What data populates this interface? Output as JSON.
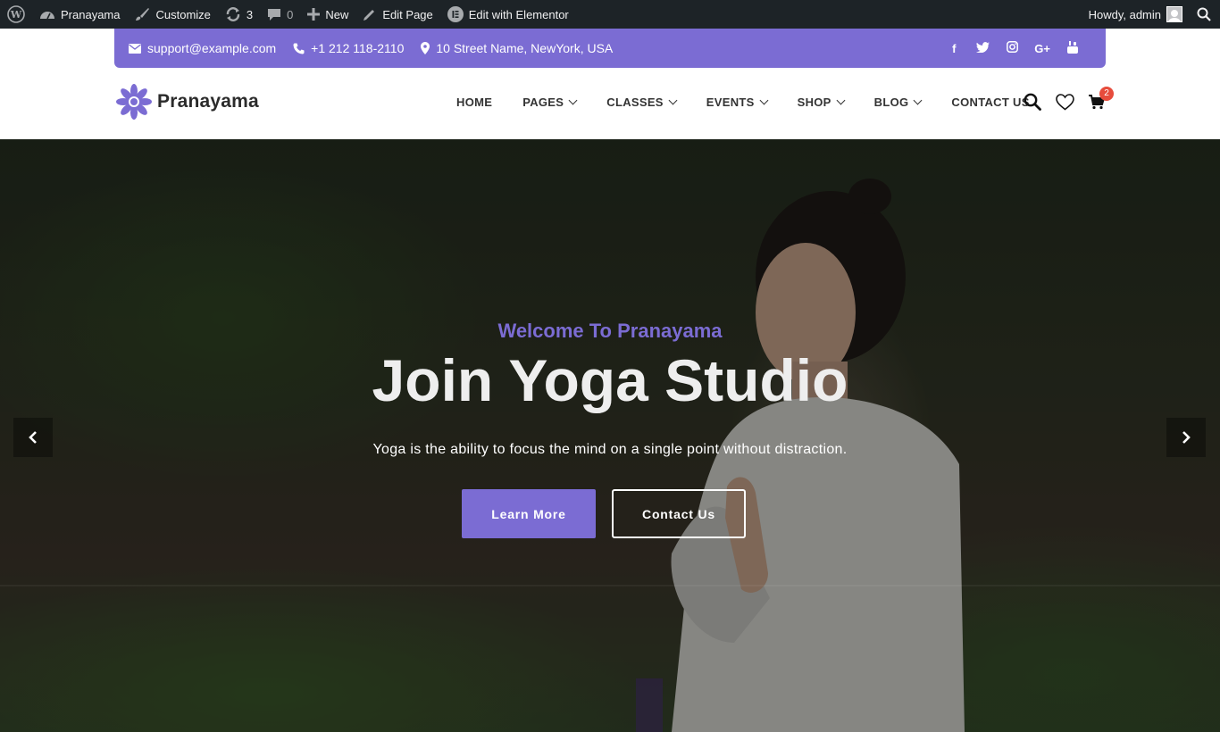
{
  "admin_bar": {
    "site_name": "Pranayama",
    "customize": "Customize",
    "updates_count": "3",
    "comments_count": "0",
    "new": "New",
    "edit_page": "Edit Page",
    "edit_elementor": "Edit with Elementor",
    "howdy": "Howdy, admin",
    "icons": [
      "wordpress-logo-icon",
      "dashboard-icon",
      "brush-icon",
      "refresh-icon",
      "comment-icon",
      "plus-icon",
      "pencil-icon",
      "elementor-icon",
      "avatar",
      "search-icon"
    ]
  },
  "topbar": {
    "email": "support@example.com",
    "phone": "+1 212 118-2110",
    "address": "10 Street Name, NewYork, USA",
    "social": [
      {
        "name": "facebook-icon",
        "glyph": "f"
      },
      {
        "name": "twitter-icon",
        "glyph": "t"
      },
      {
        "name": "instagram-icon",
        "glyph": "◎"
      },
      {
        "name": "google-plus-icon",
        "glyph": "G+"
      },
      {
        "name": "youtube-icon",
        "glyph": "▶"
      }
    ]
  },
  "header": {
    "logo_text": "Pranayama",
    "nav": [
      {
        "label": "HOME",
        "dropdown": false
      },
      {
        "label": "PAGES",
        "dropdown": true
      },
      {
        "label": "CLASSES",
        "dropdown": true
      },
      {
        "label": "EVENTS",
        "dropdown": true
      },
      {
        "label": "SHOP",
        "dropdown": true
      },
      {
        "label": "BLOG",
        "dropdown": true
      },
      {
        "label": "CONTACT US",
        "dropdown": false
      }
    ],
    "cart_count": "2"
  },
  "hero": {
    "subtitle": "Welcome To Pranayama",
    "title": "Join Yoga Studio",
    "description": "Yoga is the ability to focus the mind on a single point without distraction.",
    "primary_button": "Learn More",
    "secondary_button": "Contact Us"
  },
  "colors": {
    "accent": "#7b6cd3",
    "admin_bar": "#1d2327",
    "badge": "#e74c3c"
  }
}
